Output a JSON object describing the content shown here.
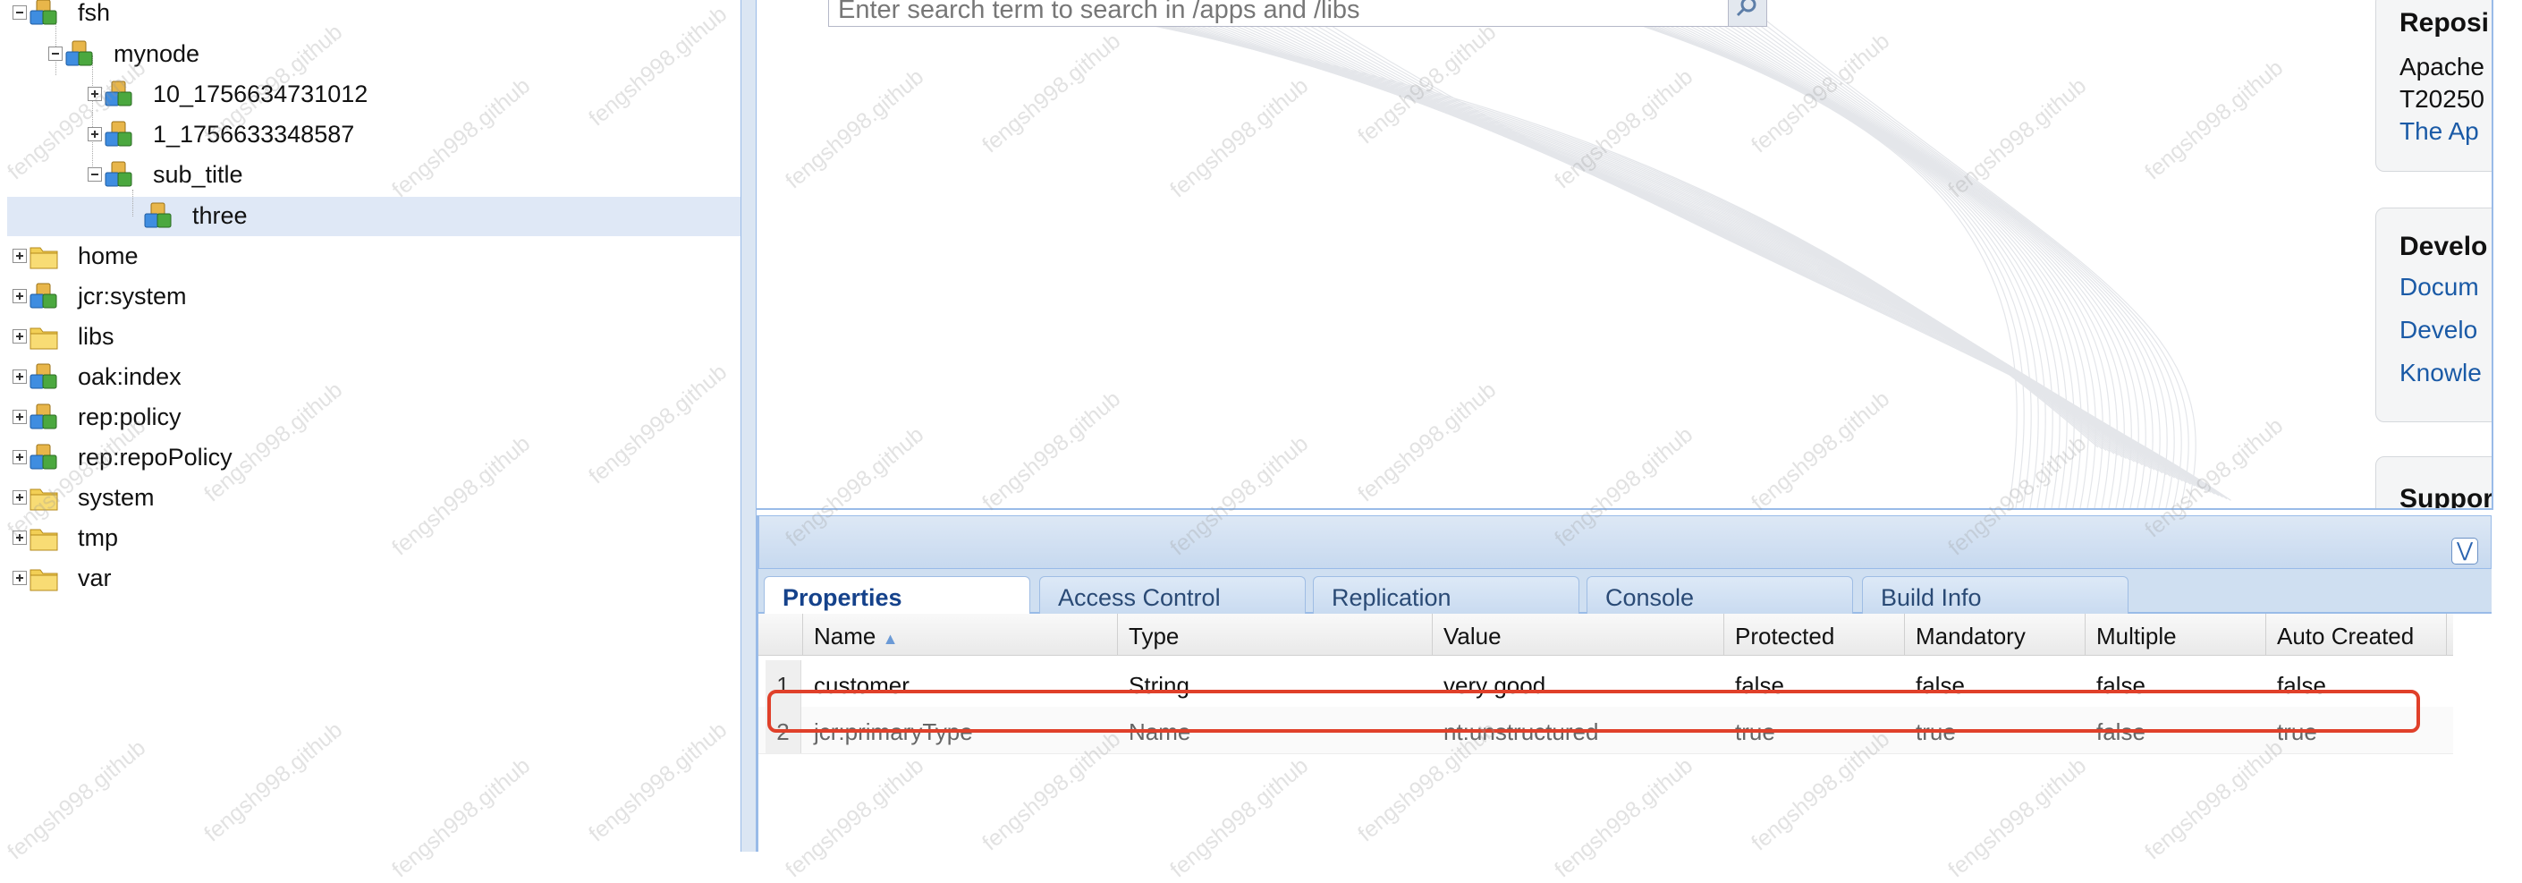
{
  "tree": {
    "items": [
      {
        "label": "fsh",
        "icon": "node-icon",
        "expander": "minus"
      },
      {
        "label": "mynode",
        "icon": "node-icon",
        "expander": "minus"
      },
      {
        "label": "10_1756634731012",
        "icon": "node-icon",
        "expander": "plus"
      },
      {
        "label": "1_1756633348587",
        "icon": "node-icon",
        "expander": "plus"
      },
      {
        "label": "sub_title",
        "icon": "node-icon",
        "expander": "minus"
      },
      {
        "label": "three",
        "icon": "node-icon",
        "expander": "none",
        "selected": true
      },
      {
        "label": "home",
        "icon": "folder-icon",
        "expander": "plus"
      },
      {
        "label": "jcr:system",
        "icon": "node-icon",
        "expander": "plus"
      },
      {
        "label": "libs",
        "icon": "folder-icon",
        "expander": "plus"
      },
      {
        "label": "oak:index",
        "icon": "node-icon",
        "expander": "plus"
      },
      {
        "label": "rep:policy",
        "icon": "node-icon",
        "expander": "plus"
      },
      {
        "label": "rep:repoPolicy",
        "icon": "node-icon",
        "expander": "plus"
      },
      {
        "label": "system",
        "icon": "folder-icon",
        "expander": "plus"
      },
      {
        "label": "tmp",
        "icon": "folder-icon",
        "expander": "plus"
      },
      {
        "label": "var",
        "icon": "folder-icon",
        "expander": "plus"
      }
    ]
  },
  "search": {
    "placeholder": "Enter search term to search in /apps and /libs"
  },
  "cards": {
    "repository": {
      "title": "Reposi",
      "line1": "Apache",
      "line2": "T20250",
      "link": "The Ap"
    },
    "developer": {
      "title": "Develo",
      "links": [
        "Docum",
        "Develo",
        "Knowle"
      ]
    },
    "support": {
      "title": "Suppor"
    }
  },
  "tabs": [
    "Properties",
    "Access Control",
    "Replication",
    "Console",
    "Build Info"
  ],
  "grid": {
    "columns": [
      "Name",
      "Type",
      "Value",
      "Protected",
      "Mandatory",
      "Multiple",
      "Auto Created"
    ],
    "sort_indicator": "▲",
    "rows": [
      {
        "num": "1",
        "name": "customer",
        "type": "String",
        "value": "very good",
        "protected": "false",
        "mandatory": "false",
        "multiple": "false",
        "auto_created": "false"
      },
      {
        "num": "2",
        "name": "jcr:primaryType",
        "type": "Name",
        "value": "nt:unstructured",
        "protected": "true",
        "mandatory": "true",
        "multiple": "false",
        "auto_created": "true"
      }
    ]
  },
  "watermark": "fengsh998.github",
  "colors": {
    "highlight_border": "#e0402a",
    "selection": "#dfe8f6",
    "link": "#1a5aa6",
    "panel_border": "#99bbe8"
  }
}
